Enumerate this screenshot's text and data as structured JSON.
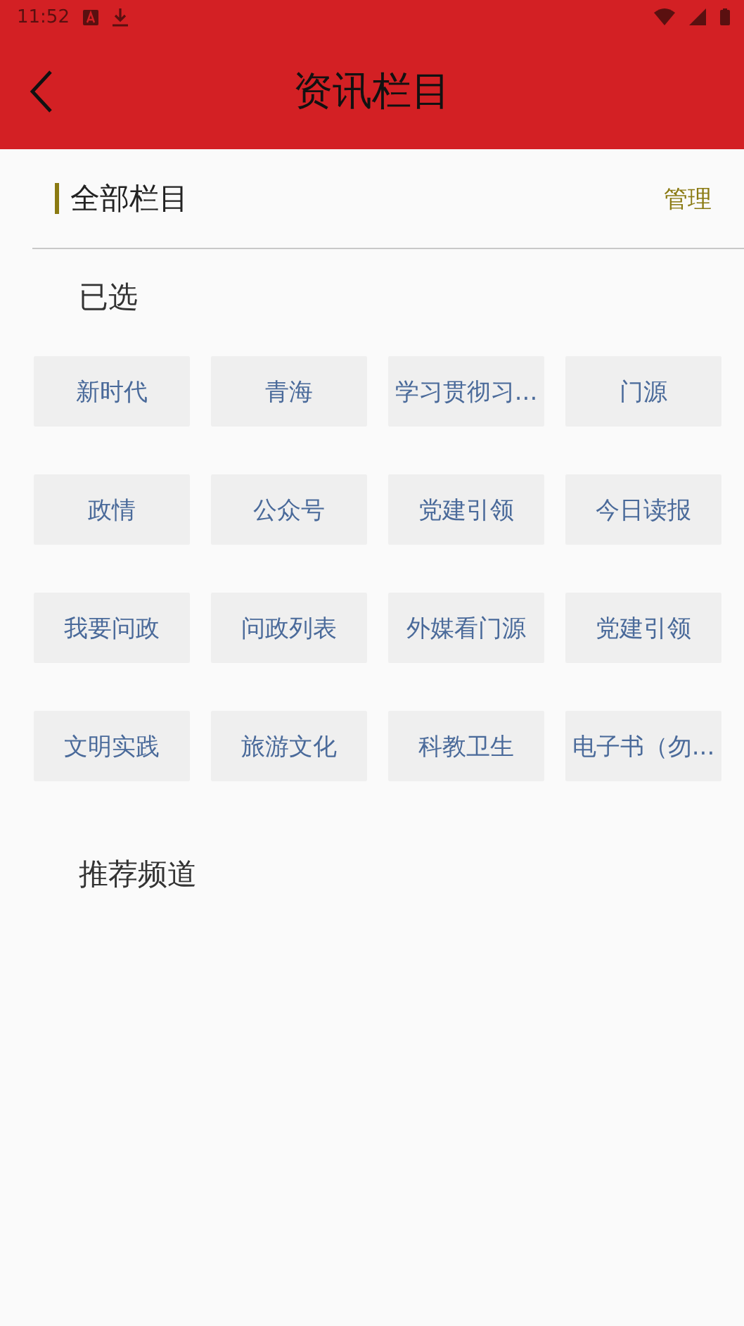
{
  "status_bar": {
    "time": "11:52"
  },
  "header": {
    "title": "资讯栏目"
  },
  "section": {
    "title": "全部栏目",
    "action": "管理"
  },
  "selected_group": {
    "title": "已选",
    "tags": [
      {
        "label": "新时代"
      },
      {
        "label": "青海"
      },
      {
        "label": "学习贯彻习..."
      },
      {
        "label": "门源"
      },
      {
        "label": "政情"
      },
      {
        "label": "公众号"
      },
      {
        "label": "党建引领"
      },
      {
        "label": "今日读报"
      },
      {
        "label": "我要问政"
      },
      {
        "label": "问政列表"
      },
      {
        "label": "外媒看门源"
      },
      {
        "label": "党建引领"
      },
      {
        "label": "文明实践"
      },
      {
        "label": "旅游文化"
      },
      {
        "label": "科教卫生"
      },
      {
        "label": "电子书（勿..."
      }
    ]
  },
  "recommended_group": {
    "title": "推荐频道"
  }
}
